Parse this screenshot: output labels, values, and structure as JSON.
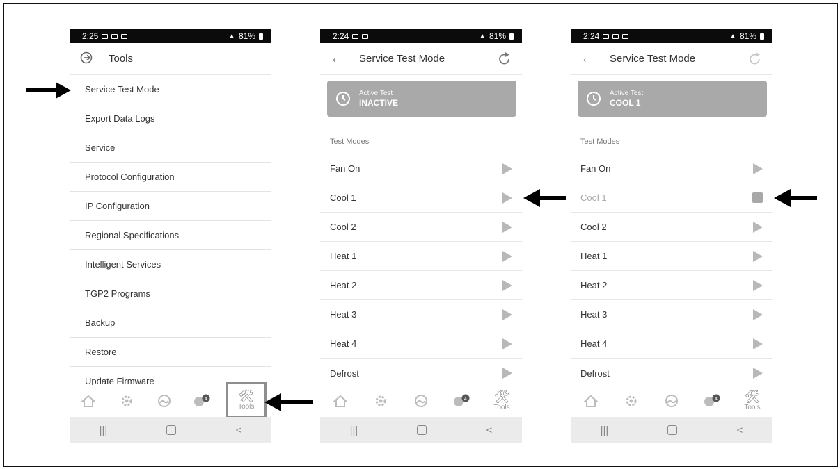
{
  "screens": [
    {
      "status": {
        "time": "2:25",
        "battery": "81%"
      },
      "appbar": {
        "title": "Tools"
      },
      "menu": [
        "Service Test Mode",
        "Export Data Logs",
        "Service",
        "Protocol Configuration",
        "IP Configuration",
        "Regional Specifications",
        "Intelligent Services",
        "TGP2 Programs",
        "Backup",
        "Restore",
        "Update Firmware"
      ],
      "nav": {
        "badge": "4",
        "tools_label": "Tools"
      }
    },
    {
      "status": {
        "time": "2:24",
        "battery": "81%"
      },
      "appbar": {
        "title": "Service Test Mode"
      },
      "active_test": {
        "label": "Active Test",
        "value": "INACTIVE"
      },
      "section_label": "Test Modes",
      "tests": [
        "Fan On",
        "Cool 1",
        "Cool 2",
        "Heat 1",
        "Heat 2",
        "Heat 3",
        "Heat 4",
        "Defrost"
      ],
      "nav": {
        "badge": "4",
        "tools_label": "Tools"
      }
    },
    {
      "status": {
        "time": "2:24",
        "battery": "81%"
      },
      "appbar": {
        "title": "Service Test Mode"
      },
      "active_test": {
        "label": "Active Test",
        "value": "COOL 1"
      },
      "section_label": "Test Modes",
      "tests": [
        "Fan On",
        "Cool 1",
        "Cool 2",
        "Heat 1",
        "Heat 2",
        "Heat 3",
        "Heat 4",
        "Defrost"
      ],
      "running_test": "Cool 1",
      "nav": {
        "badge": "4",
        "tools_label": "Tools"
      }
    }
  ],
  "colors": {
    "status_bar": "#0b0b0b",
    "active_card": "#a9a9a9",
    "arrow": "#000000",
    "icon_gray": "#b8b8b8"
  }
}
